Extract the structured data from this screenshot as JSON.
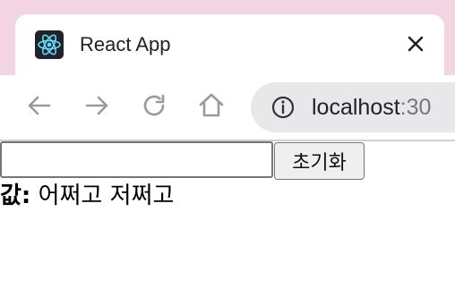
{
  "tab": {
    "title": "React App",
    "favicon_icon": "react-logo-icon",
    "close_icon": "close-icon"
  },
  "toolbar": {
    "back_icon": "back-arrow-icon",
    "forward_icon": "forward-arrow-icon",
    "reload_icon": "reload-icon",
    "home_icon": "home-icon",
    "site_info_icon": "info-icon",
    "url_host": "localhost",
    "url_port": ":30"
  },
  "page": {
    "input_value": "",
    "reset_button_label": "초기화",
    "value_label": "값:",
    "value_text": "어쩌고 저쩌고"
  },
  "colors": {
    "tabstrip_bg": "#f2d4e2",
    "omnibox_bg": "#e8e8ea",
    "react_blue": "#61dafb"
  }
}
